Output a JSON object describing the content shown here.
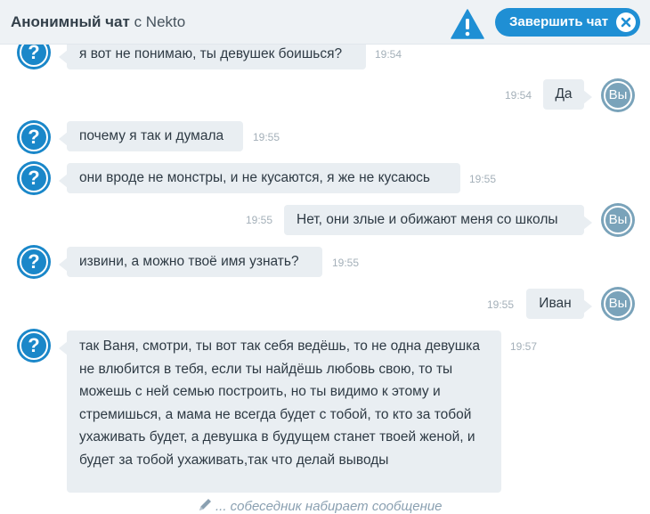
{
  "header": {
    "title_strong": "Анонимный чат",
    "title_rest": "с Nekto",
    "end_button_label": "Завершить чат"
  },
  "messages": [
    {
      "from": "stranger",
      "text": "я вот не понимаю, ты девушек боишься?",
      "time": "19:54"
    },
    {
      "from": "me",
      "text": "Да",
      "time": "19:54"
    },
    {
      "from": "stranger",
      "text": "почему я так и думала",
      "time": "19:55"
    },
    {
      "from": "stranger",
      "text": "они вроде не монстры, и не кусаются, я же не кусаюсь",
      "time": "19:55"
    },
    {
      "from": "me",
      "text": "Нет, они злые и обижают меня со школы",
      "time": "19:55"
    },
    {
      "from": "stranger",
      "text": "извини, а можно твоё имя узнать?",
      "time": "19:55"
    },
    {
      "from": "me",
      "text": "Иван",
      "time": "19:55"
    },
    {
      "from": "stranger",
      "text": "так Ваня, смотри, ты вот так себя ведёшь, то не одна девушка не влюбится в тебя, если ты найдёшь любовь свою, то ты можешь с ней семью построить, но ты видимо к этому и стремишься, а мама не всегда будет с тобой, то кто за тобой ухаживать будет, а девушка в будущем станет твоей женой, и будет за тобой ухаживать,так что делай выводы",
      "time": "19:57"
    }
  ],
  "avatars": {
    "stranger_symbol": "?",
    "me_label": "Вы"
  },
  "typing_indicator": "... собеседник набирает сообщение",
  "colors": {
    "accent": "#1f8fd4",
    "avatar_stranger": "#1a87c9",
    "avatar_me": "#7aa3ba",
    "bubble": "#e9eef2"
  }
}
